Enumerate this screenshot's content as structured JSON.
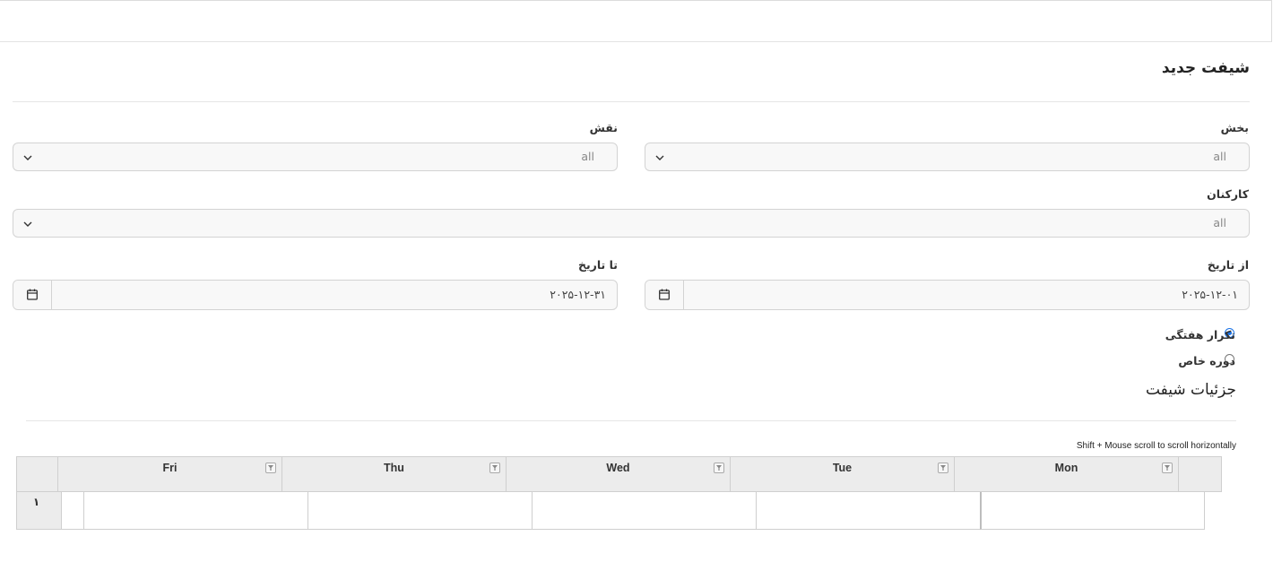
{
  "page": {
    "title": "شیفت جدید"
  },
  "form": {
    "department": {
      "label": "بخش",
      "value": "all"
    },
    "role": {
      "label": "نقش",
      "value": "all"
    },
    "staff": {
      "label": "کارکنان",
      "value": "all"
    },
    "from_date": {
      "label": "از تاریخ",
      "value": "۲۰۲۵-۱۲-۰۱"
    },
    "to_date": {
      "label": "تا تاریخ",
      "value": "۲۰۲۵-۱۲-۳۱"
    },
    "repeat": {
      "options": [
        {
          "label": "تکرار هفتگی",
          "checked": true
        },
        {
          "label": "دوره خاص",
          "checked": false
        }
      ]
    }
  },
  "shift_details": {
    "title": "جزئیات شیفت",
    "hint": "Shift + Mouse scroll to scroll horizontally",
    "columns": [
      "Fri",
      "Thu",
      "Wed",
      "Tue",
      "Mon"
    ],
    "rows": [
      {
        "num": "۱"
      }
    ]
  },
  "icons": {
    "select": "chevron-down-icon",
    "date": "calendar-icon",
    "column": "filter-icon"
  },
  "colors": {
    "radio_accent": "#1a73e8",
    "header_bg": "#ececec",
    "field_bg": "#f8f8f8"
  }
}
